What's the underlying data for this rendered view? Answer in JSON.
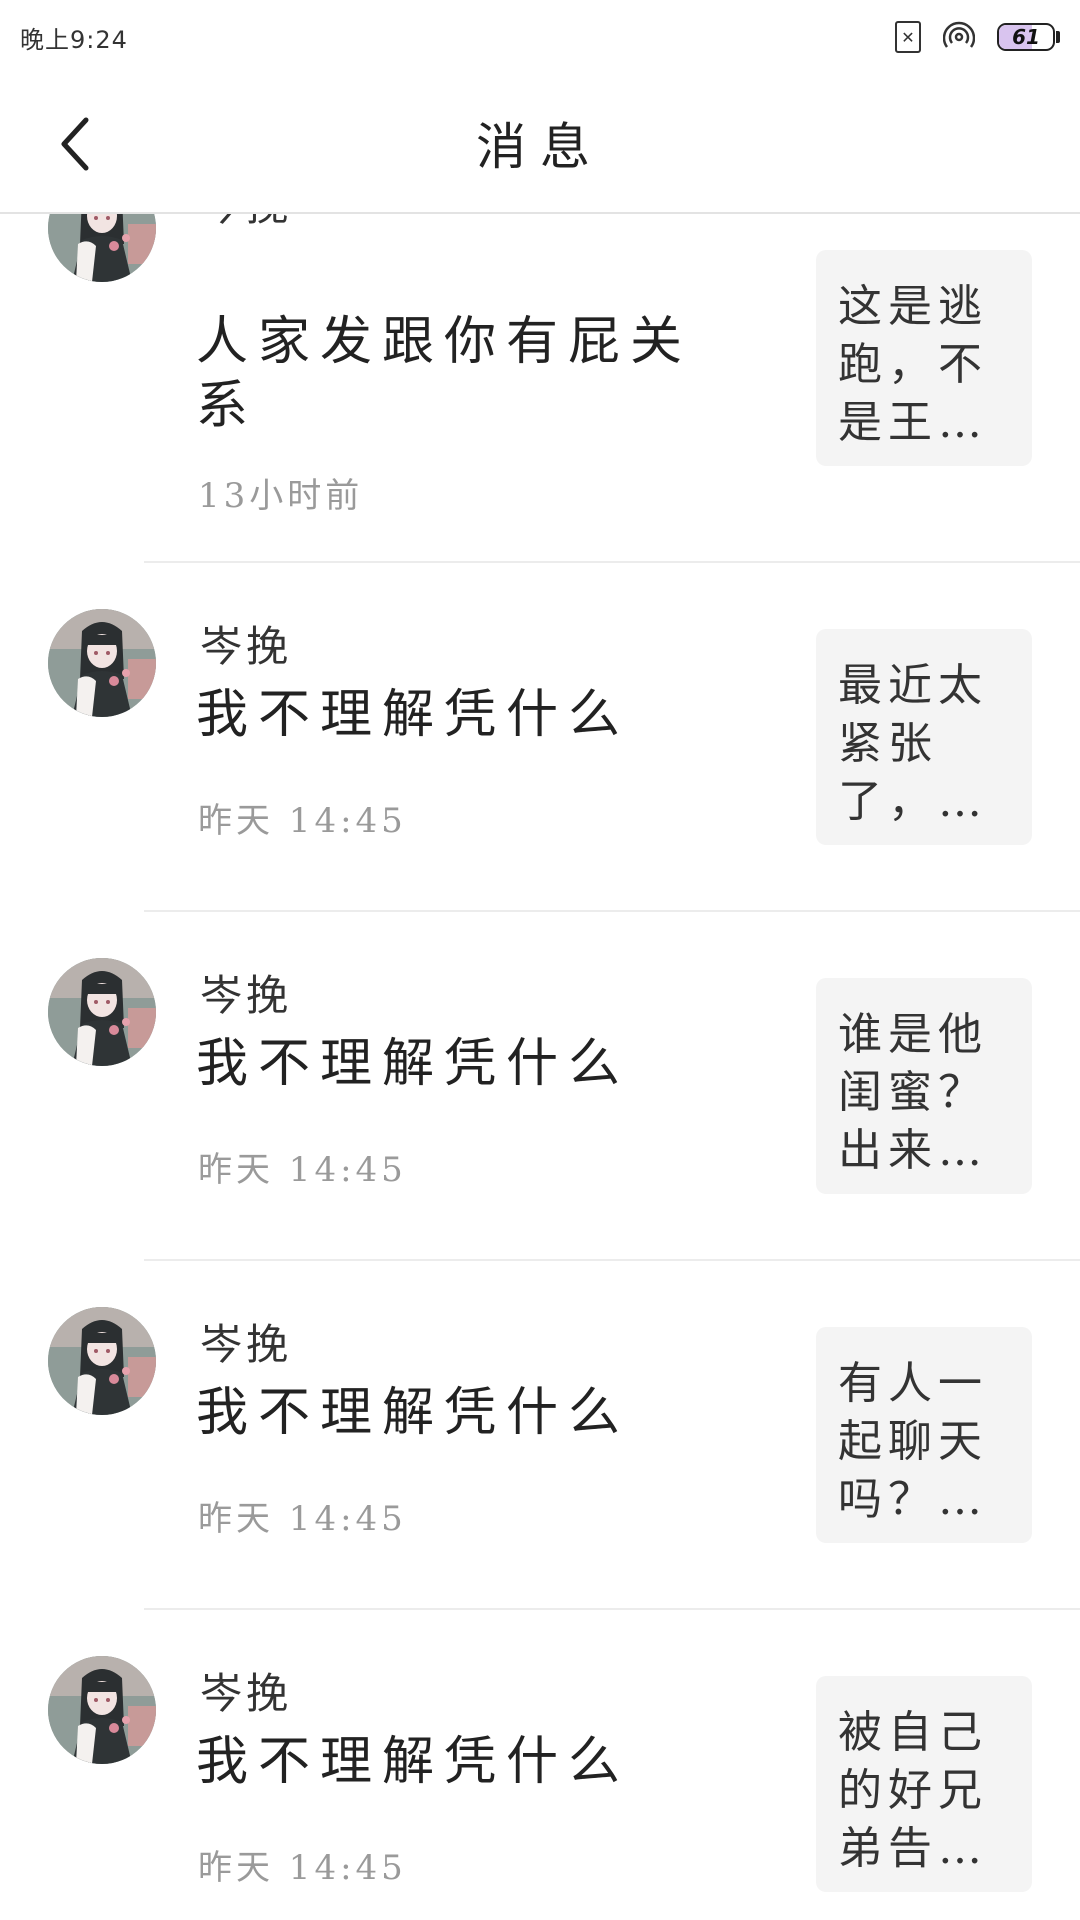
{
  "status_bar": {
    "time": "晚上9:24",
    "battery_level": "61",
    "battery_fraction": 0.61
  },
  "header": {
    "title": "消息"
  },
  "messages": [
    {
      "sender": "岑挽",
      "content": "人家发跟你有屁关系",
      "time": "13小时前",
      "quote": "这是逃跑，不是王…"
    },
    {
      "sender": "岑挽",
      "content": "我不理解凭什么",
      "time": "昨天 14:45",
      "quote": "最近太紧张了，…"
    },
    {
      "sender": "岑挽",
      "content": "我不理解凭什么",
      "time": "昨天 14:45",
      "quote": "谁是他闺蜜？出来…"
    },
    {
      "sender": "岑挽",
      "content": "我不理解凭什么",
      "time": "昨天 14:45",
      "quote": "有人一起聊天吗？…"
    },
    {
      "sender": "岑挽",
      "content": "我不理解凭什么",
      "time": "昨天 14:45",
      "quote": "被自己的好兄弟告…"
    }
  ]
}
